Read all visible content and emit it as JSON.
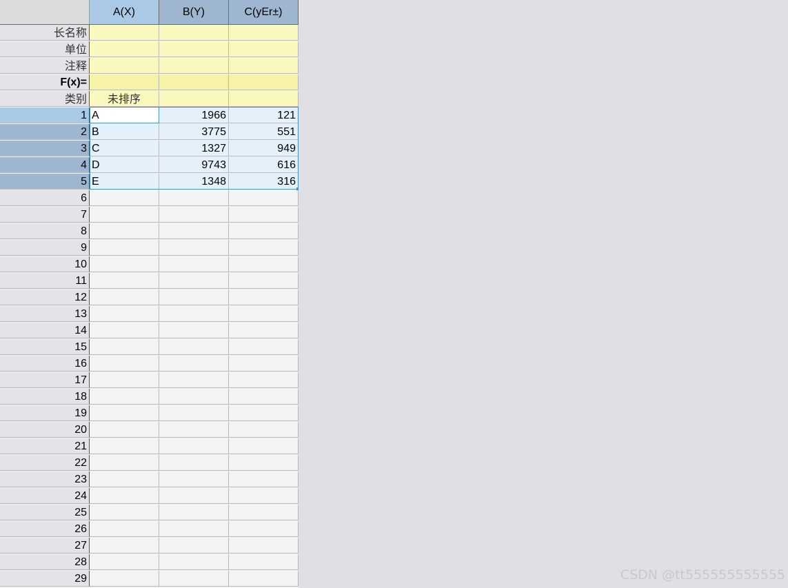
{
  "columns": [
    {
      "header": "A(X)"
    },
    {
      "header": "B(Y)"
    },
    {
      "header": "C(yEr±)"
    }
  ],
  "meta_rows": {
    "long_name": "长名称",
    "units": "单位",
    "comments": "注释",
    "fx": "F(x)=",
    "categories": "类别",
    "category_a_value": "未排序"
  },
  "rows": [
    {
      "num": "1",
      "a": "A",
      "b": "1966",
      "c": "121"
    },
    {
      "num": "2",
      "a": "B",
      "b": "3775",
      "c": "551"
    },
    {
      "num": "3",
      "a": "C",
      "b": "1327",
      "c": "949"
    },
    {
      "num": "4",
      "a": "D",
      "b": "9743",
      "c": "616"
    },
    {
      "num": "5",
      "a": "E",
      "b": "1348",
      "c": "316"
    }
  ],
  "empty_rows": [
    "6",
    "7",
    "8",
    "9",
    "10",
    "11",
    "12",
    "13",
    "14",
    "15",
    "16",
    "17",
    "18",
    "19",
    "20",
    "21",
    "22",
    "23",
    "24",
    "25",
    "26",
    "27",
    "28",
    "29"
  ],
  "watermark": "CSDN @tt555555555555",
  "colors": {
    "selected_header": "#9fb6d0",
    "active_header": "#a9c9e6",
    "label_rows": "#fbf8bd",
    "selection_fill": "#e4f1fa",
    "selection_border": "#4a90c8"
  }
}
